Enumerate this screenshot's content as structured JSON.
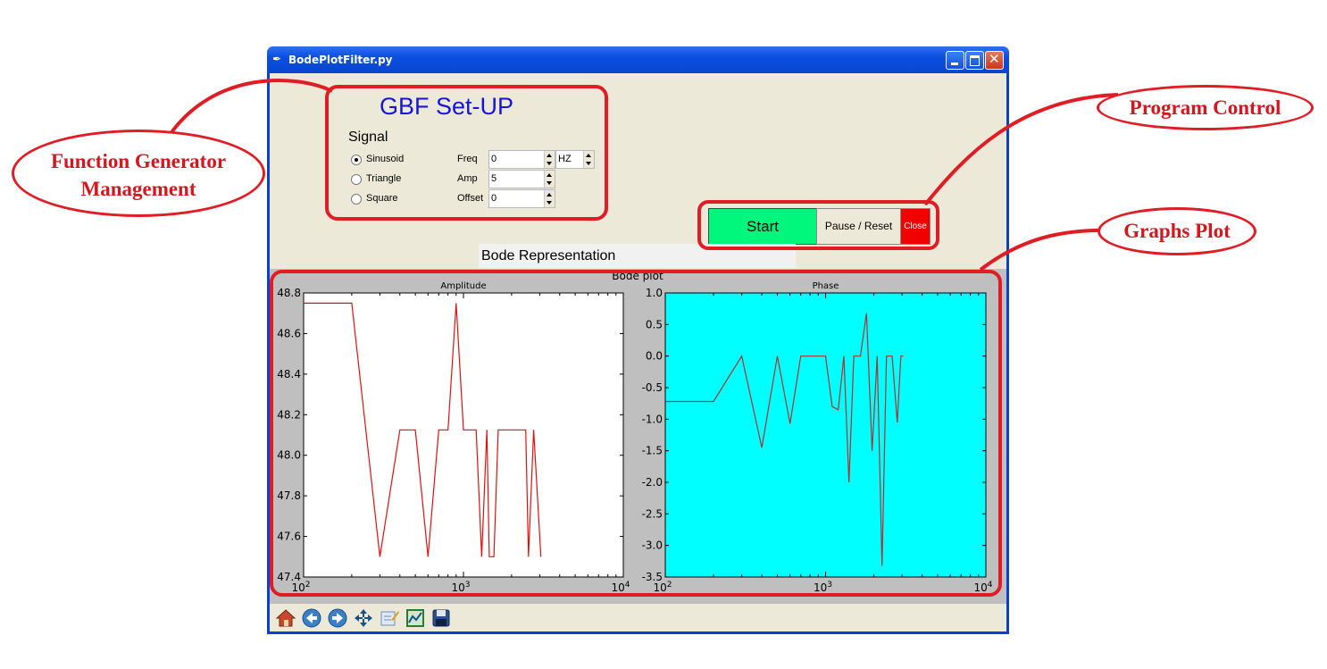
{
  "window": {
    "title": "BodePlotFilter.py"
  },
  "gbf": {
    "title": "GBF Set-UP",
    "signal_label": "Signal",
    "waveforms": [
      {
        "label": "Sinusoid",
        "selected": true
      },
      {
        "label": "Triangle",
        "selected": false
      },
      {
        "label": "Square",
        "selected": false
      }
    ],
    "freq_label": "Freq",
    "freq_value": "0",
    "freq_unit": "HZ",
    "amp_label": "Amp",
    "amp_value": "5",
    "offset_label": "Offset",
    "offset_value": "0"
  },
  "controls": {
    "start_label": "Start",
    "pause_label": "Pause / Reset",
    "close_label": "Close",
    "start_color": "#00f77b",
    "close_color": "#f00000"
  },
  "section_label": "Bode Representation",
  "annotations": {
    "function_generator": [
      "Function Generator",
      "Management"
    ],
    "program_control": "Program Control",
    "graphs_plot": "Graphs Plot",
    "color": "#e01c24"
  },
  "toolbar_icons": [
    "home-icon",
    "back-icon",
    "forward-icon",
    "pan-icon",
    "configure-subplots-icon",
    "zoom-icon",
    "save-icon"
  ],
  "chart_data": [
    {
      "type": "line",
      "suptitle": "Bode plot",
      "title": "Amplitude",
      "xscale": "log",
      "xlim": [
        100,
        10000
      ],
      "xticks": [
        "10^2",
        "10^3",
        "10^4"
      ],
      "ylim": [
        47.4,
        48.8
      ],
      "yticks": [
        "47.4",
        "47.6",
        "47.8",
        "48.0",
        "48.2",
        "48.4",
        "48.6",
        "48.8"
      ],
      "background": "#ffffff",
      "line_color": "#e01010",
      "series": [
        {
          "x": [
            100,
            200,
            300,
            400,
            500,
            600,
            700,
            800,
            900,
            1000,
            1100,
            1200,
            1300,
            1400,
            1450,
            1550,
            1650,
            2000,
            2450,
            2550,
            2750,
            3050
          ],
          "y": [
            48.75,
            48.75,
            47.5,
            48.125,
            48.125,
            47.5,
            48.125,
            48.125,
            48.75,
            48.125,
            48.125,
            48.125,
            47.5,
            48.125,
            47.5,
            47.5,
            48.125,
            48.125,
            48.125,
            47.5,
            48.125,
            47.5
          ]
        }
      ]
    },
    {
      "type": "line",
      "title": "Phase",
      "xscale": "log",
      "xlim": [
        100,
        10000
      ],
      "xticks": [
        "10^2",
        "10^3",
        "10^4"
      ],
      "ylim": [
        -3.5,
        1.0
      ],
      "yticks": [
        "1.0",
        "0.5",
        "0.0",
        "-0.5",
        "-1.0",
        "-1.5",
        "-2.0",
        "-2.5",
        "-3.0",
        "-3.5"
      ],
      "background": "#00ffff",
      "line_color": "#b03030",
      "series": [
        {
          "x": [
            100,
            200,
            300,
            400,
            500,
            600,
            700,
            800,
            900,
            1000,
            1100,
            1200,
            1300,
            1400,
            1500,
            1650,
            1800,
            1950,
            2100,
            2250,
            2400,
            2600,
            2800,
            2950,
            3050
          ],
          "y": [
            -0.72,
            -0.72,
            0.0,
            -1.45,
            0.0,
            -1.07,
            0.0,
            0.0,
            0.0,
            0.0,
            -0.8,
            -0.85,
            0.0,
            -2.0,
            0.0,
            0.0,
            0.68,
            -1.5,
            0.0,
            -3.32,
            0.0,
            0.0,
            -1.05,
            0.0,
            0.0
          ]
        }
      ]
    }
  ]
}
